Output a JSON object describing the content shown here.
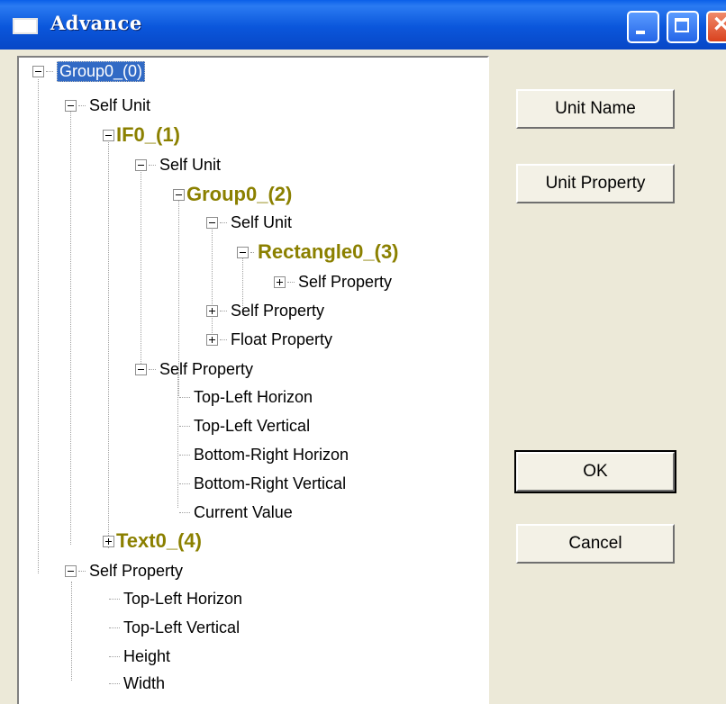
{
  "window": {
    "title": "Advance",
    "controls": [
      "minimize",
      "maximize",
      "close"
    ]
  },
  "buttons": {
    "unit_name": "Unit Name",
    "unit_property": "Unit Property",
    "ok": "OK",
    "cancel": "Cancel"
  },
  "tree": {
    "n0": "Group0_(0)",
    "n1": "Self Unit",
    "n2": "IF0_(1)",
    "n3": "Self Unit",
    "n4": "Group0_(2)",
    "n5": "Self Unit",
    "n6": "Rectangle0_(3)",
    "n7": "Self Property",
    "n8": "Self Property",
    "n9": "Float Property",
    "n10": "Self Property",
    "n11": "Top-Left Horizon",
    "n12": "Top-Left Vertical",
    "n13": "Bottom-Right Horizon",
    "n14": "Bottom-Right Vertical",
    "n15": "Current Value",
    "n16": "Text0_(4)",
    "n17": "Self Property",
    "n18": "Top-Left Horizon",
    "n19": "Top-Left Vertical",
    "n20": "Height",
    "n21": "Width"
  },
  "selected_node": "Group0_(0)",
  "colors": {
    "titlebar": "#0A56DB",
    "selection": "#316AC5",
    "unit_node_text": "#8B8000",
    "dialog_bg": "#ECE9D8"
  }
}
